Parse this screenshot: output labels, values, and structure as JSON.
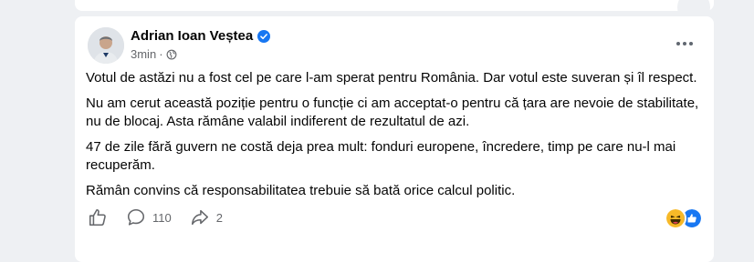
{
  "post": {
    "author": "Adrian Ioan Veștea",
    "time": "3min",
    "separator": "·",
    "paragraphs": [
      "Votul de astăzi nu a fost cel pe care l-am sperat pentru România. Dar votul este suveran și îl respect.",
      "Nu am cerut această poziție pentru o funcție ci am acceptat-o pentru că țara are nevoie de stabilitate, nu de blocaj. Asta rămâne valabil indiferent de rezultatul de azi.",
      "47 de zile fără guvern ne costă deja prea mult: fonduri europene, încredere, timp pe care nu-l mai recuperăm.",
      "Rămân convins că responsabilitatea trebuie să bată orice calcul politic."
    ],
    "comments_count": "110",
    "shares_count": "2"
  },
  "icons": {
    "verified": "verified-badge-icon",
    "audience": "globe-icon",
    "more": "more-options-icon",
    "like": "like-icon",
    "comment": "comment-icon",
    "share": "share-icon",
    "reaction_haha": "haha-reaction-icon",
    "reaction_like": "like-reaction-icon"
  },
  "colors": {
    "page_bg": "#eef0f3",
    "card_bg": "#ffffff",
    "accent_blue": "#1877f2",
    "secondary_text": "#65676b",
    "haha_yellow": "#f7b928"
  }
}
